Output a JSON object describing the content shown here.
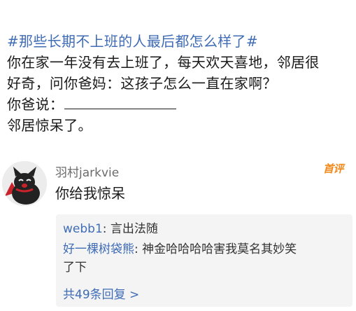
{
  "post": {
    "hashtag": "#那些长期不上班的人最后都怎么样了#",
    "line1": "你在家一年没有去上班了，每天欢天喜地，邻居很",
    "line2": "好奇，问你爸妈：这孩子怎么一直在家啊？",
    "line3_prefix": "你爸说：",
    "line4": "邻居惊呆了。"
  },
  "comment": {
    "avatar_icon": "black-cat-avatar-icon",
    "username": "羽村jarkvie",
    "badge": "首评",
    "text": "你给我惊呆",
    "replies": [
      {
        "name": "webb1",
        "separator": ": ",
        "text": "言出法随"
      },
      {
        "name": "好一棵树袋熊",
        "separator": ": ",
        "text": "神金哈哈哈哈害我莫名其妙笑",
        "text_cont": "了下"
      }
    ],
    "more_label": "共49条回复 >"
  },
  "colors": {
    "link_blue": "#3f6cb5",
    "badge_orange": "#f08a1c",
    "reply_bg": "#f4f4f4"
  }
}
